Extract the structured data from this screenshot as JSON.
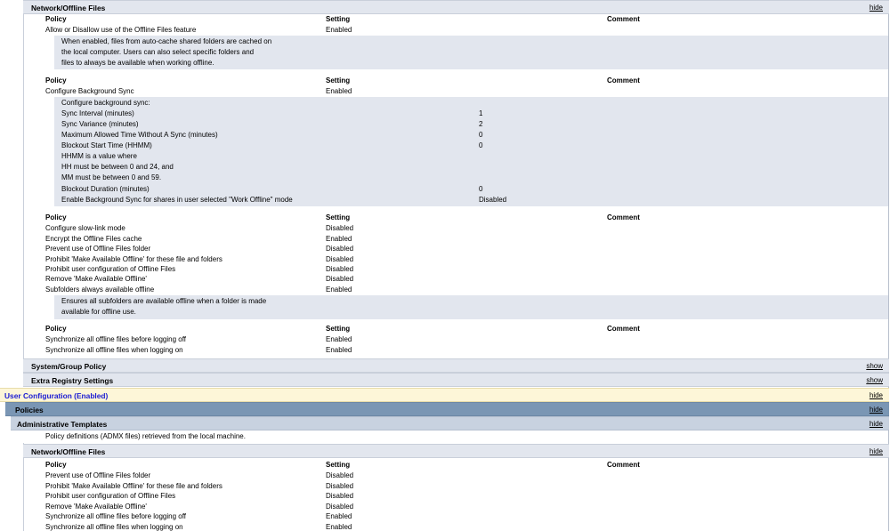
{
  "sections": {
    "network_offline_1": {
      "title": "Network/Offline Files",
      "link": "hide"
    },
    "system_group_policy": {
      "title": "System/Group Policy",
      "link": "show"
    },
    "extra_registry": {
      "title": "Extra Registry Settings",
      "link": "show"
    },
    "user_config": {
      "title": "User Configuration (Enabled)",
      "link": "hide"
    },
    "policies": {
      "title": "Policies",
      "link": "hide"
    },
    "admin_templates": {
      "title": "Administrative Templates",
      "link": "hide"
    },
    "network_offline_2": {
      "title": "Network/Offline Files",
      "link": "hide"
    }
  },
  "headers": {
    "policy": "Policy",
    "setting": "Setting",
    "comment": "Comment"
  },
  "table1": {
    "rows": [
      {
        "policy": "Allow or Disallow use of the Offline Files feature",
        "setting": "Enabled"
      }
    ],
    "desc": [
      "When enabled, files from auto-cache shared folders are cached on",
      "the local computer. Users can also select specific folders and",
      "files to always be available when working offline."
    ]
  },
  "table2": {
    "rows": [
      {
        "policy": "Configure Background Sync",
        "setting": "Enabled"
      }
    ],
    "desc": [
      {
        "k": "Configure background sync:",
        "v": ""
      },
      {
        "k": "Sync Interval (minutes)",
        "v": "1"
      },
      {
        "k": "Sync Variance (minutes)",
        "v": "2"
      },
      {
        "k": "Maximum Allowed Time Without A Sync (minutes)",
        "v": "0"
      },
      {
        "k": "Blockout Start Time (HHMM)",
        "v": "0"
      },
      {
        "k": "HHMM is a value where",
        "v": ""
      },
      {
        "k": "HH must be between 0 and 24, and",
        "v": ""
      },
      {
        "k": "MM must be between 0 and 59.",
        "v": ""
      },
      {
        "k": "Blockout Duration (minutes)",
        "v": "0"
      },
      {
        "k": "Enable Background Sync for shares in user selected \"Work Offline\" mode",
        "v": "Disabled"
      }
    ]
  },
  "table3": {
    "rows": [
      {
        "policy": "Configure slow-link mode",
        "setting": "Disabled"
      },
      {
        "policy": "Encrypt the Offline Files cache",
        "setting": "Enabled"
      },
      {
        "policy": "Prevent use of Offline Files folder",
        "setting": "Disabled"
      },
      {
        "policy": "Prohibit 'Make Available Offline' for these file and folders",
        "setting": "Disabled"
      },
      {
        "policy": "Prohibit user configuration of Offline Files",
        "setting": "Disabled"
      },
      {
        "policy": "Remove 'Make Available Offline'",
        "setting": "Disabled"
      },
      {
        "policy": "Subfolders always available offline",
        "setting": "Enabled"
      }
    ],
    "desc": [
      "Ensures all subfolders are available offline when a folder is made",
      "available for offline use."
    ]
  },
  "table4": {
    "rows": [
      {
        "policy": "Synchronize all offline files before logging off",
        "setting": "Enabled"
      },
      {
        "policy": "Synchronize all offline files when logging on",
        "setting": "Enabled"
      }
    ]
  },
  "admx_note": "Policy definitions (ADMX files) retrieved from the local machine.",
  "table5": {
    "rows": [
      {
        "policy": "Prevent use of Offline Files folder",
        "setting": "Disabled"
      },
      {
        "policy": "Prohibit 'Make Available Offline' for these file and folders",
        "setting": "Disabled"
      },
      {
        "policy": "Prohibit user configuration of Offline Files",
        "setting": "Disabled"
      },
      {
        "policy": "Remove 'Make Available Offline'",
        "setting": "Disabled"
      },
      {
        "policy": "Synchronize all offline files before logging off",
        "setting": "Enabled"
      },
      {
        "policy": "Synchronize all offline files when logging on",
        "setting": "Enabled"
      }
    ]
  }
}
